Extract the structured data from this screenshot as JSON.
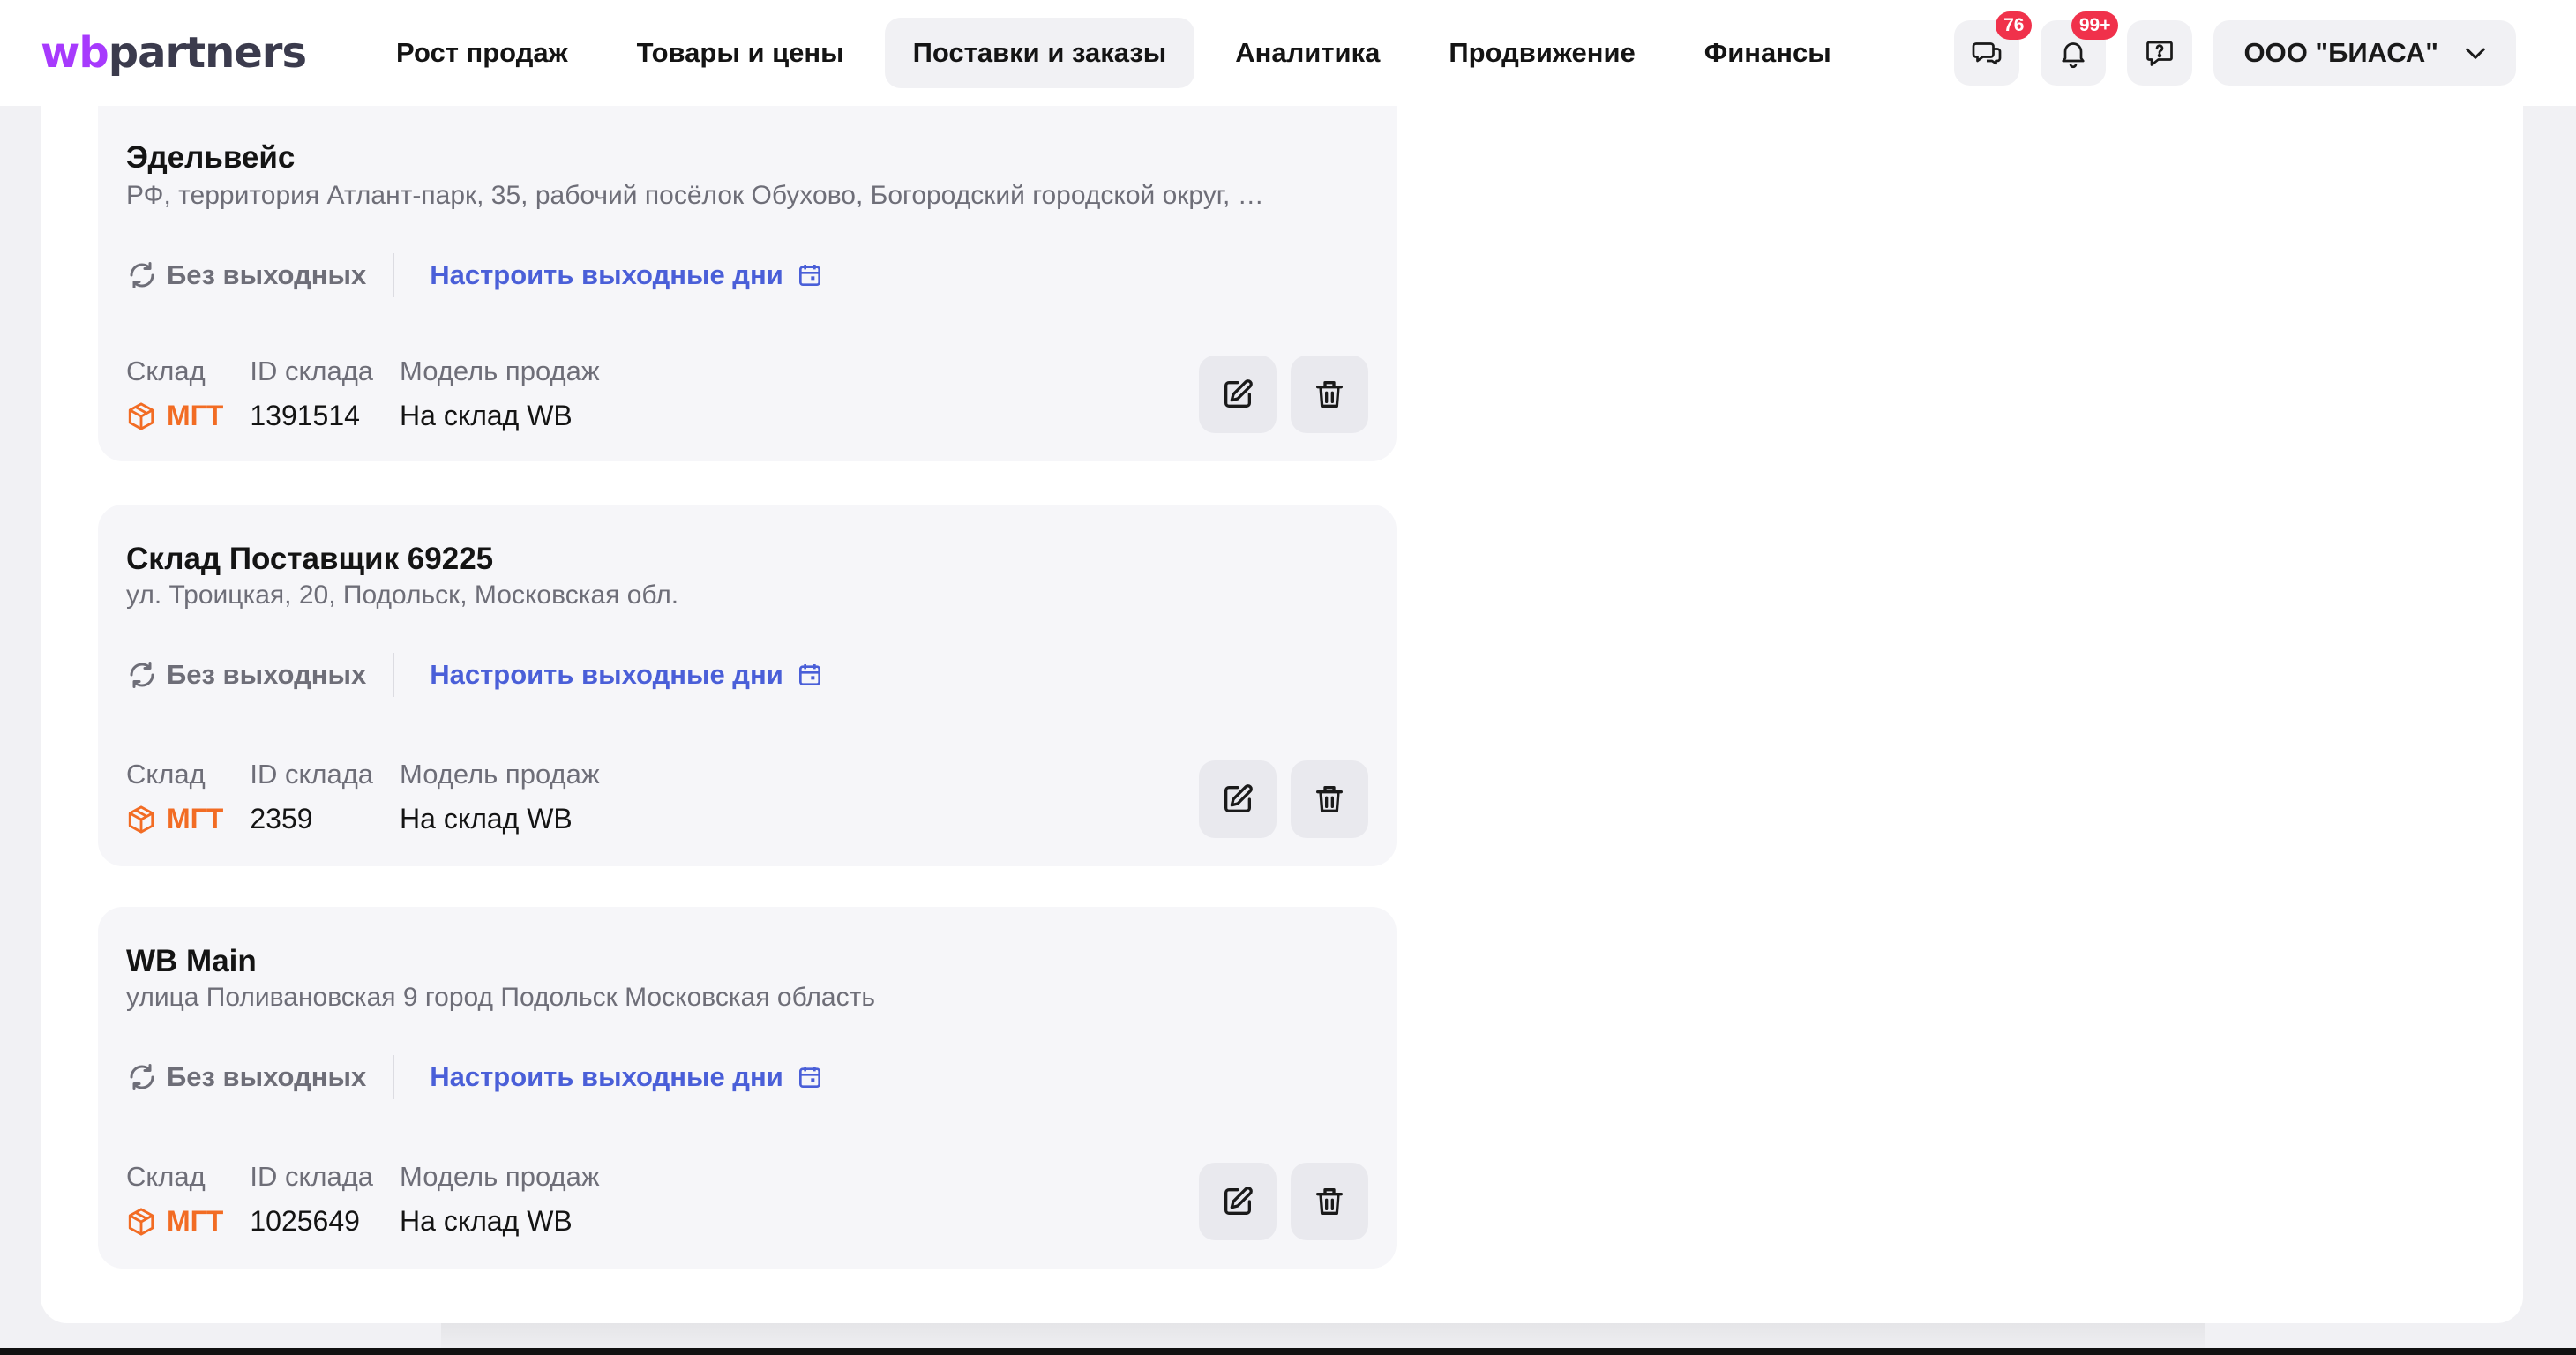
{
  "header": {
    "logo_wb": "wb",
    "logo_rest": "partners",
    "nav": [
      {
        "label": "Рост продаж",
        "active": false
      },
      {
        "label": "Товары и цены",
        "active": false
      },
      {
        "label": "Поставки и заказы",
        "active": true
      },
      {
        "label": "Аналитика",
        "active": false
      },
      {
        "label": "Продвижение",
        "active": false
      },
      {
        "label": "Финансы",
        "active": false
      }
    ],
    "chat_badge": "76",
    "notifications_badge": "99+",
    "company": "ООО \"БИАСА\""
  },
  "labels": {
    "no_days_off": "Без выходных",
    "configure_days_off": "Настроить выходные дни",
    "warehouse": "Склад",
    "warehouse_id": "ID склада",
    "sales_model": "Модель продаж"
  },
  "warehouses": [
    {
      "title": "Эдельвейс",
      "address": "РФ, территория Атлант-парк, 35, рабочий посёлок Обухово, Богородский городской округ, …",
      "type": "МГТ",
      "id": "1391514",
      "model": "На склад WB"
    },
    {
      "title": "Склад Поставщик 69225",
      "address": "ул. Троицкая, 20, Подольск, Московская обл.",
      "type": "МГТ",
      "id": "2359",
      "model": "На склад WB"
    },
    {
      "title": "WB Main",
      "address": "улица Поливановская 9 город Подольск Московская область",
      "type": "МГТ",
      "id": "1025649",
      "model": "На склад WB"
    }
  ],
  "colors": {
    "brand_purple": "#a73afd",
    "link_blue": "#4a5fd8",
    "mgt_orange": "#f26c24",
    "badge_red": "#f0314b"
  }
}
